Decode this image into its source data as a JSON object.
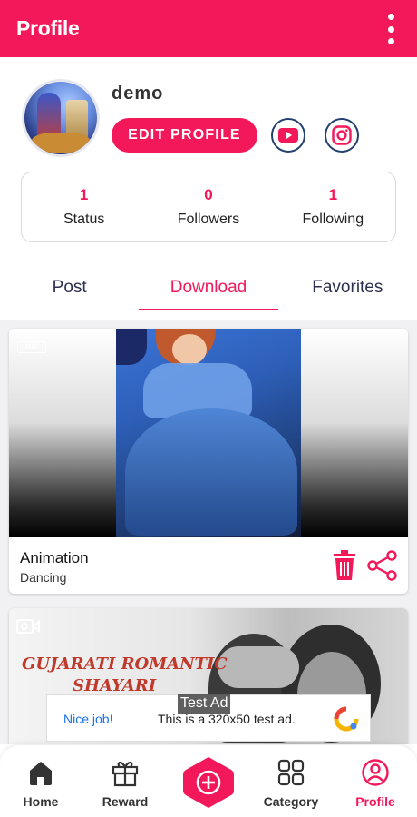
{
  "appbar": {
    "title": "Profile",
    "menu_icon": "more-vert-icon"
  },
  "profile": {
    "username": "demo",
    "edit_label": "EDIT PROFILE",
    "social": [
      {
        "icon": "youtube-icon"
      },
      {
        "icon": "instagram-icon"
      }
    ]
  },
  "stats": [
    {
      "value": "1",
      "label": "Status"
    },
    {
      "value": "0",
      "label": "Followers"
    },
    {
      "value": "1",
      "label": "Following"
    }
  ],
  "tabs": [
    {
      "label": "Post",
      "active": false
    },
    {
      "label": "Download",
      "active": true
    },
    {
      "label": "Favorites",
      "active": false
    }
  ],
  "feed": [
    {
      "badge": "GIF",
      "title": "Animation",
      "category": "Dancing",
      "type": "gif"
    },
    {
      "type": "video",
      "overlay_text_line1": "GUJARATI ROMANTIC",
      "overlay_text_line2": "SHAYARI"
    }
  ],
  "ad": {
    "label": "Test Ad",
    "nice": "Nice job!",
    "text": "This is a 320x50 test ad."
  },
  "nav": {
    "home": "Home",
    "reward": "Reward",
    "category": "Category",
    "profile": "Profile"
  },
  "colors": {
    "accent": "#f2185a",
    "social_border": "#24406e",
    "text_dark": "#2d3150"
  }
}
